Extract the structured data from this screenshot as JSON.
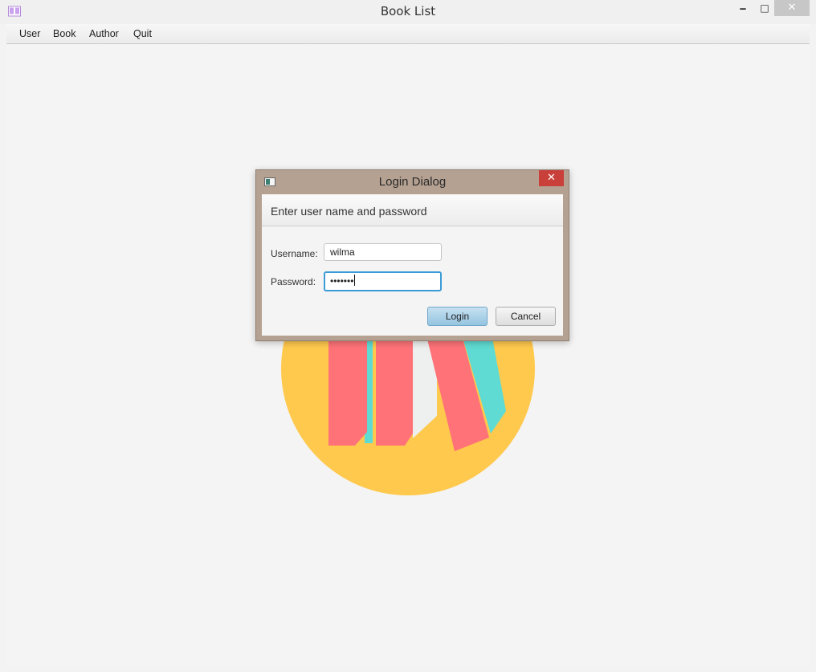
{
  "window": {
    "title": "Book List",
    "minimize_glyph": "🗕",
    "maximize_glyph": "□",
    "close_glyph": "✕"
  },
  "menu": {
    "items": [
      {
        "label": "User"
      },
      {
        "label": "Book"
      },
      {
        "label": "Author"
      },
      {
        "label": "Quit"
      }
    ]
  },
  "dialog": {
    "title": "Login Dialog",
    "close_glyph": "✕",
    "header_text": "Enter user name and password",
    "username_label": "Username:",
    "username_value": "wilma",
    "password_label": "Password:",
    "password_value": "•••••••",
    "login_label": "Login",
    "cancel_label": "Cancel"
  },
  "colors": {
    "accent": "#3a9bd6",
    "dialog_frame": "#b5a191",
    "logo_circle": "#ffc94d",
    "logo_coral": "#ff7378",
    "logo_teal": "#5fdbd3"
  },
  "icons": {
    "app": "book-icon",
    "dialog": "window-icon"
  }
}
